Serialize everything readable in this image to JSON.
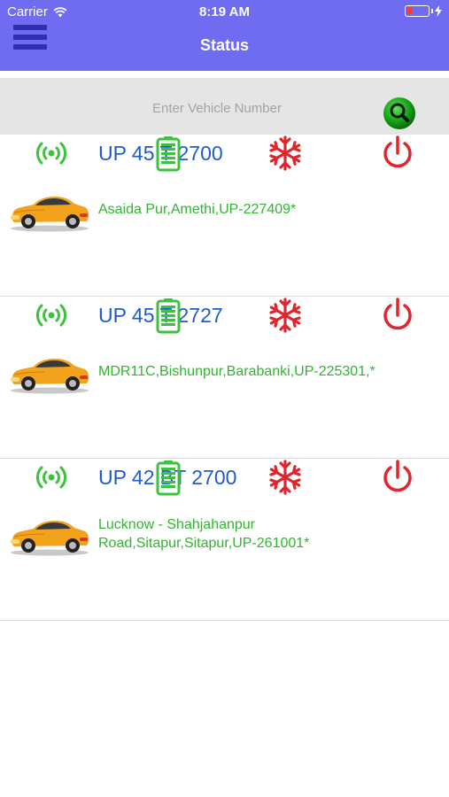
{
  "status_bar": {
    "carrier": "Carrier",
    "time": "8:19 AM"
  },
  "header": {
    "title": "Status",
    "menu_icon": "hamburger-icon",
    "background": "#6f6cf2"
  },
  "search": {
    "placeholder": "Enter Vehicle Number",
    "button_icon": "search-icon"
  },
  "colors": {
    "plate": "#1e5bd0",
    "address": "#2fb52f",
    "signal": "#3cc23c",
    "battery": "#3cc23c",
    "ac": "#e0262d",
    "power": "#e0262d"
  },
  "vehicles": [
    {
      "plate": "UP 45 T 2700",
      "address": "Asaida Pur,Amethi,UP-227409*",
      "icons": [
        "signal-icon",
        "battery-icon",
        "snowflake-icon",
        "power-icon"
      ]
    },
    {
      "plate": "UP 45 T 2727",
      "address": "MDR11C,Bishunpur,Barabanki,UP-225301,*",
      "icons": [
        "signal-icon",
        "battery-icon",
        "snowflake-icon",
        "power-icon"
      ]
    },
    {
      "plate": "UP 42 BT 2700",
      "address": "Lucknow - Shahjahanpur Road,Sitapur,Sitapur,UP-261001*",
      "icons": [
        "signal-icon",
        "battery-icon",
        "snowflake-icon",
        "power-icon"
      ]
    }
  ]
}
